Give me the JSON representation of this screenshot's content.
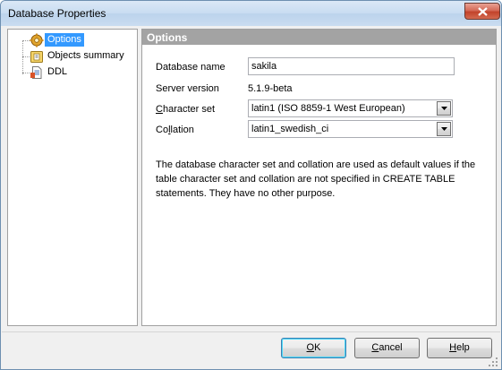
{
  "window": {
    "title": "Database Properties"
  },
  "tree": {
    "items": [
      {
        "label": "Options",
        "icon": "options-gear-icon",
        "selected": true
      },
      {
        "label": "Objects summary",
        "icon": "objects-summary-icon",
        "selected": false
      },
      {
        "label": "DDL",
        "icon": "ddl-document-icon",
        "selected": false
      }
    ]
  },
  "panel": {
    "header": "Options",
    "fields": {
      "database_name": {
        "label": "Database name",
        "value": "sakila"
      },
      "server_version": {
        "label": "Server version",
        "value": "5.1.9-beta"
      },
      "character_set": {
        "label_first": "C",
        "label_rest": "haracter set",
        "value": "latin1 (ISO 8859-1 West European)"
      },
      "collation": {
        "label_pre": "Co",
        "label_u": "l",
        "label_post": "lation",
        "value": "latin1_swedish_ci"
      }
    },
    "note": "The database character set and collation are used as default values if the table character set and collation are not specified in CREATE TABLE statements. They have no other purpose."
  },
  "buttons": {
    "ok": {
      "u": "O",
      "rest": "K"
    },
    "cancel": {
      "u": "C",
      "rest": "ancel"
    },
    "help": {
      "u": "H",
      "rest": "elp"
    }
  },
  "colors": {
    "selection": "#3399ff",
    "panel_header": "#a3a3a3",
    "close_button": "#c2432b"
  }
}
